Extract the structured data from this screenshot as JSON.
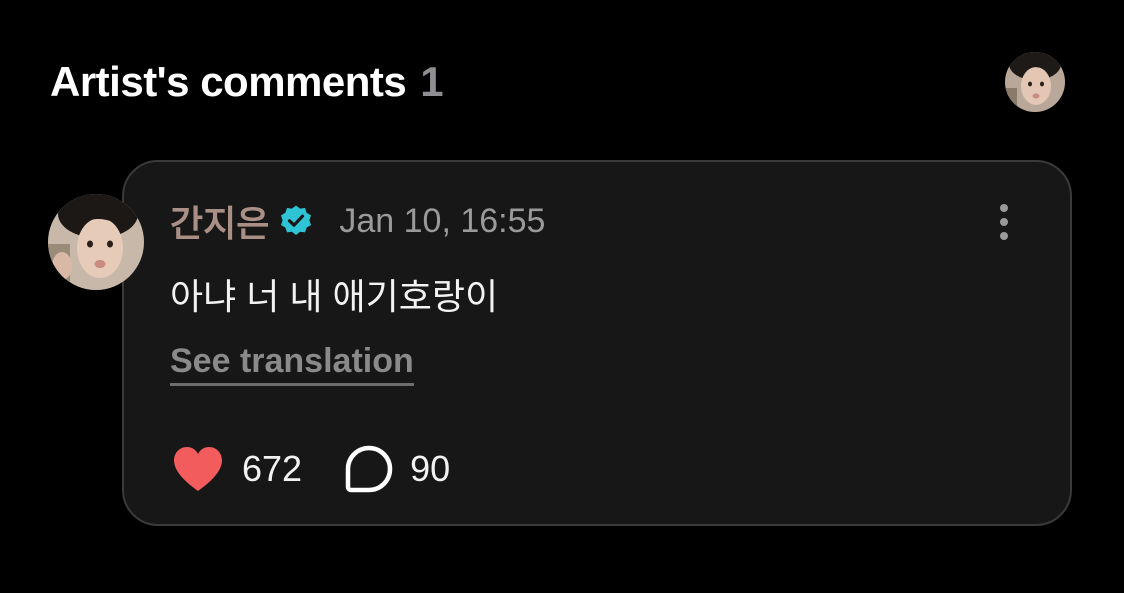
{
  "header": {
    "title": "Artist's comments",
    "count": "1"
  },
  "comment": {
    "author": "간지은",
    "timestamp": "Jan 10, 16:55",
    "text": "아냐 너 내 애기호랑이",
    "see_translation_label": "See translation",
    "likes": "672",
    "replies": "90"
  },
  "icons": {
    "verified": "verified-badge-icon",
    "more": "more-vertical-icon",
    "like": "heart-icon",
    "reply": "comment-bubble-icon"
  },
  "colors": {
    "background": "#000000",
    "card": "#171717",
    "card_border": "#3a3a3a",
    "author_name": "#a98f86",
    "verified": "#2ec4d6",
    "heart": "#f25c5c",
    "muted_text": "#9a9a9a"
  }
}
